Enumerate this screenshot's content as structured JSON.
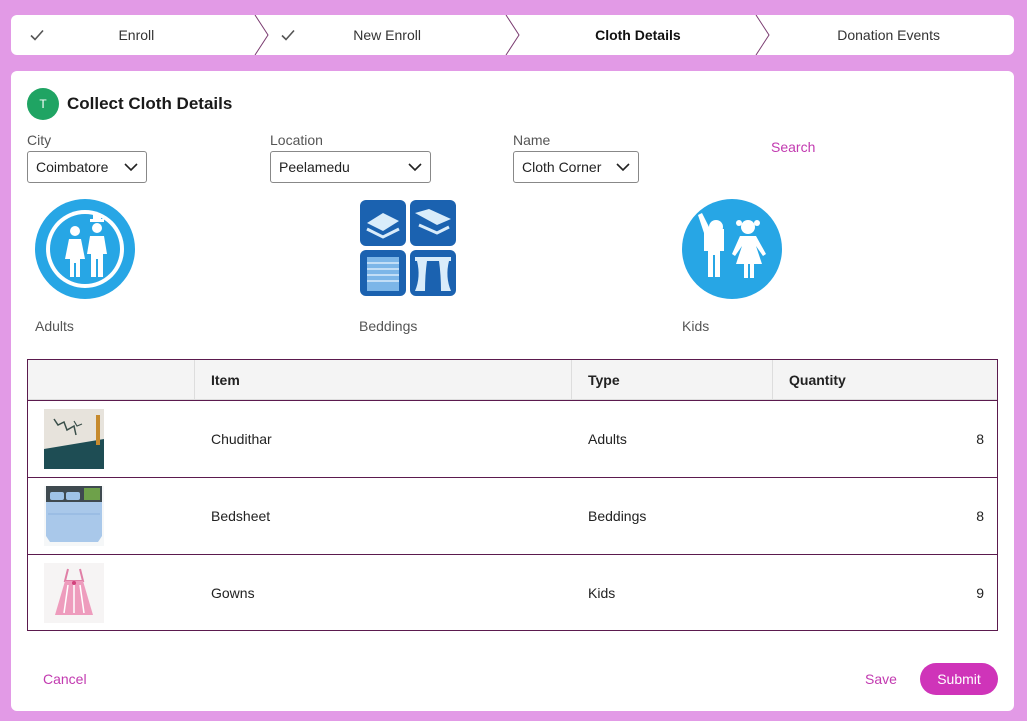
{
  "stepper": {
    "steps": [
      {
        "label": "Enroll",
        "done": true
      },
      {
        "label": "New Enroll",
        "done": true
      },
      {
        "label": "Cloth Details",
        "active": true
      },
      {
        "label": "Donation Events"
      }
    ]
  },
  "header": {
    "avatar": "T",
    "title": "Collect Cloth Details"
  },
  "filters": {
    "city": {
      "label": "City",
      "value": "Coimbatore"
    },
    "location": {
      "label": "Location",
      "value": "Peelamedu"
    },
    "name": {
      "label": "Name",
      "value": "Cloth Corner"
    },
    "search": "Search"
  },
  "categories": [
    {
      "label": "Adults",
      "icon": "adults-icon"
    },
    {
      "label": "Beddings",
      "icon": "beddings-icon"
    },
    {
      "label": "Kids",
      "icon": "kids-icon"
    }
  ],
  "table": {
    "columns": [
      "",
      "Item",
      "Type",
      "Quantity"
    ],
    "rows": [
      {
        "item": "Chudithar",
        "type": "Adults",
        "quantity": "8"
      },
      {
        "item": "Bedsheet",
        "type": "Beddings",
        "quantity": "8"
      },
      {
        "item": "Gowns",
        "type": "Kids",
        "quantity": "9"
      }
    ]
  },
  "footer": {
    "cancel": "Cancel",
    "save": "Save",
    "submit": "Submit"
  },
  "colors": {
    "accent": "#cf34b9",
    "background": "#e29ae6",
    "avatar": "#1fa463",
    "icon_blue": "#27a6e5"
  }
}
